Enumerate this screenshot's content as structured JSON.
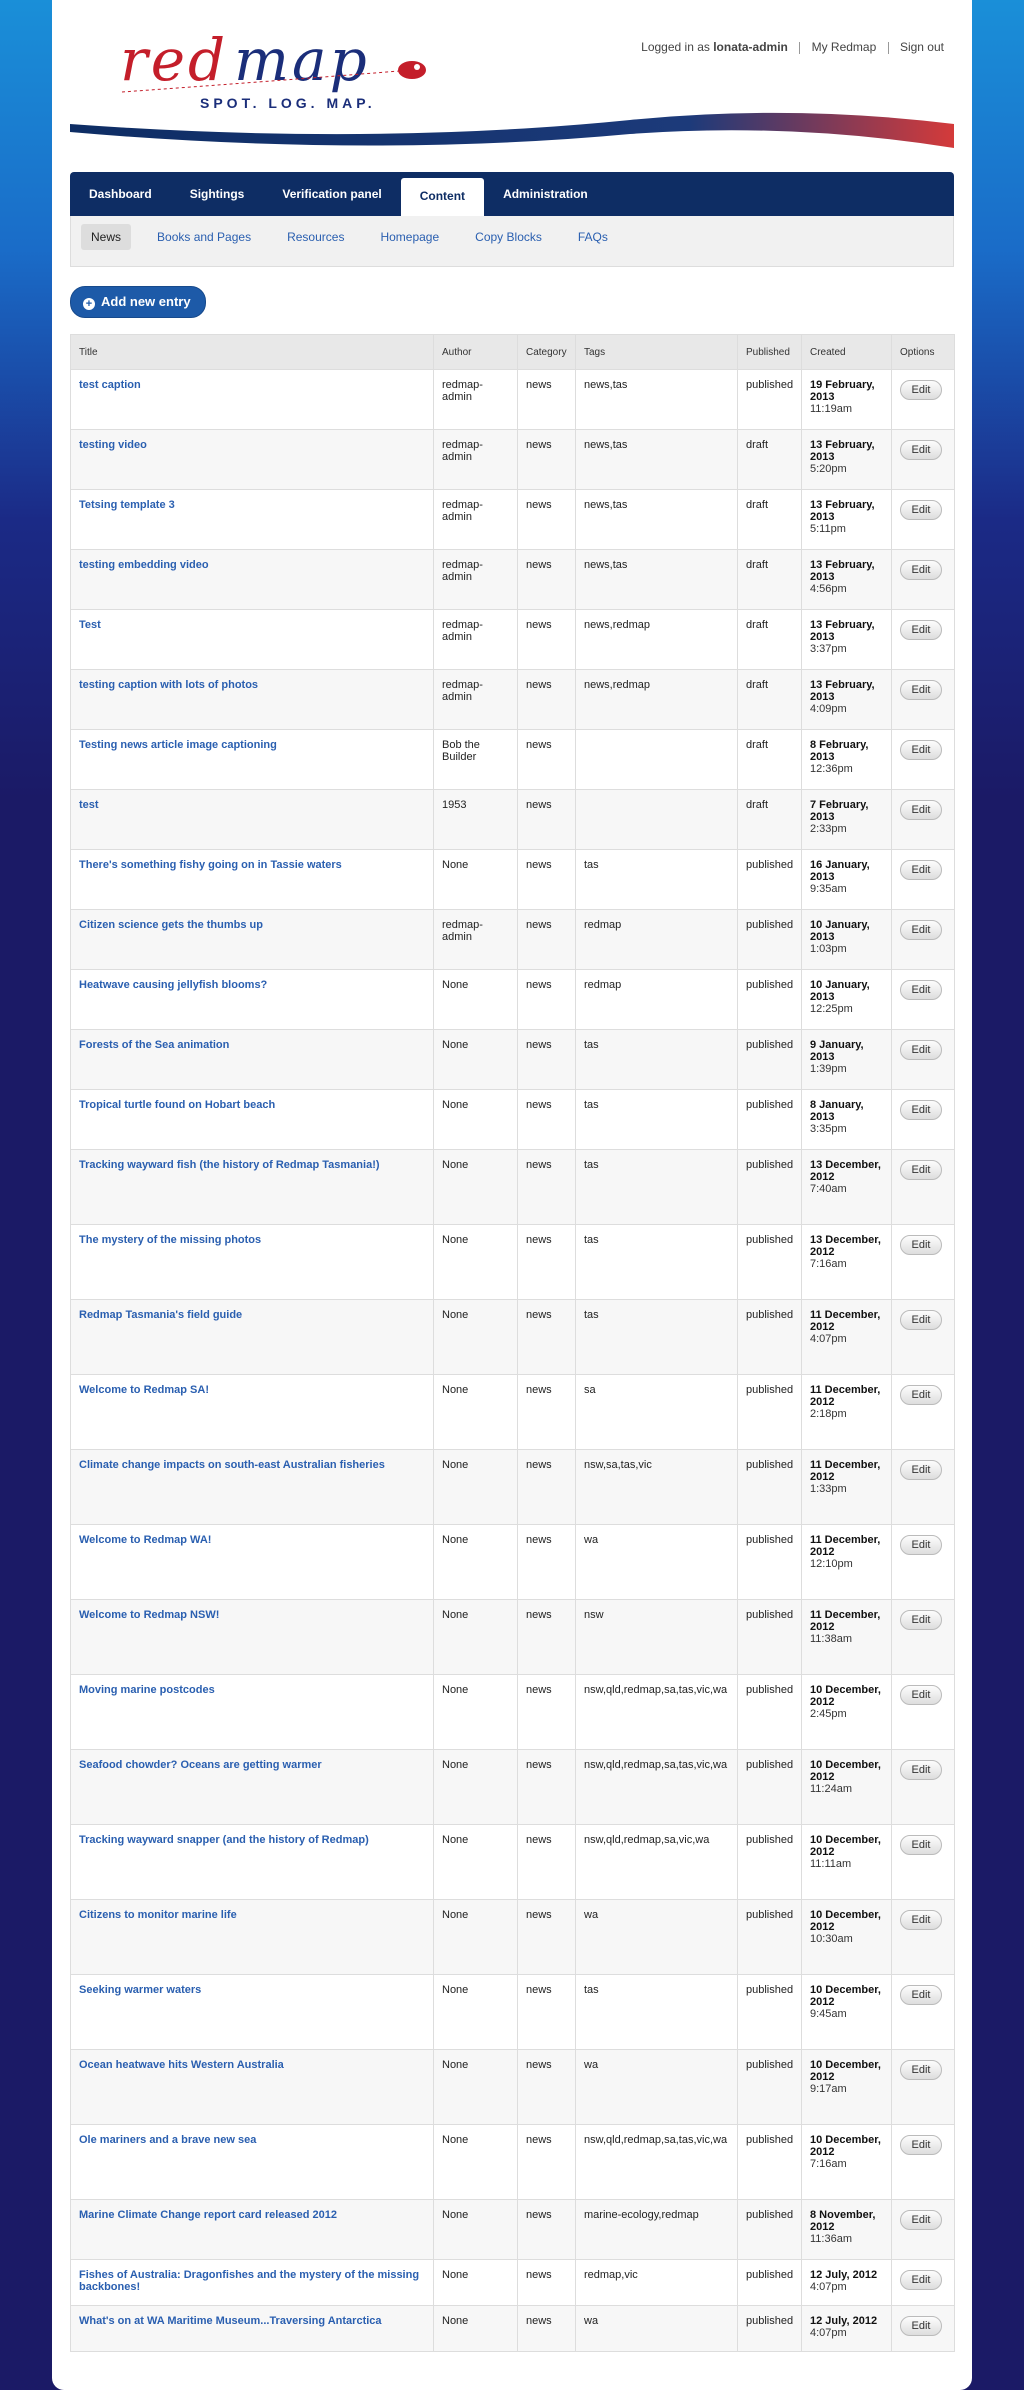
{
  "header": {
    "logo": "redmap",
    "tagline": "SPOT. LOG. MAP.",
    "logged_in_prefix": "Logged in as ",
    "username": "lonata-admin",
    "my_redmap": "My Redmap",
    "sign_out": "Sign out"
  },
  "nav": {
    "items": [
      "Dashboard",
      "Sightings",
      "Verification panel",
      "Content",
      "Administration"
    ],
    "active": "Content"
  },
  "subnav": {
    "items": [
      "News",
      "Books and Pages",
      "Resources",
      "Homepage",
      "Copy Blocks",
      "FAQs"
    ],
    "active": "News"
  },
  "add_button": "Add new entry",
  "table": {
    "headers": [
      "Title",
      "Author",
      "Category",
      "Tags",
      "Published",
      "Created",
      "Options"
    ],
    "edit_label": "Edit",
    "rows": [
      {
        "title": "test caption",
        "author": "redmap-admin",
        "category": "news",
        "tags": "news,tas",
        "published": "published",
        "date": "19 February, 2013",
        "time": "11:19am"
      },
      {
        "title": "testing video",
        "author": "redmap-admin",
        "category": "news",
        "tags": "news,tas",
        "published": "draft",
        "date": "13 February, 2013",
        "time": "5:20pm"
      },
      {
        "title": "Tetsing template 3",
        "author": "redmap-admin",
        "category": "news",
        "tags": "news,tas",
        "published": "draft",
        "date": "13 February, 2013",
        "time": "5:11pm"
      },
      {
        "title": "testing embedding video",
        "author": "redmap-admin",
        "category": "news",
        "tags": "news,tas",
        "published": "draft",
        "date": "13 February, 2013",
        "time": "4:56pm"
      },
      {
        "title": "Test",
        "author": "redmap-admin",
        "category": "news",
        "tags": "news,redmap",
        "published": "draft",
        "date": "13 February, 2013",
        "time": "3:37pm"
      },
      {
        "title": "testing caption with lots of photos",
        "author": "redmap-admin",
        "category": "news",
        "tags": "news,redmap",
        "published": "draft",
        "date": "13 February, 2013",
        "time": "4:09pm"
      },
      {
        "title": "Testing news article image captioning",
        "author": "Bob the Builder",
        "category": "news",
        "tags": "",
        "published": "draft",
        "date": "8 February, 2013",
        "time": "12:36pm"
      },
      {
        "title": "test",
        "author": "1953",
        "category": "news",
        "tags": "",
        "published": "draft",
        "date": "7 February, 2013",
        "time": "2:33pm"
      },
      {
        "title": "There's something fishy going on in Tassie waters",
        "author": "None",
        "category": "news",
        "tags": "tas",
        "published": "published",
        "date": "16 January, 2013",
        "time": "9:35am"
      },
      {
        "title": "Citizen science gets the thumbs up",
        "author": "redmap-admin",
        "category": "news",
        "tags": "redmap",
        "published": "published",
        "date": "10 January, 2013",
        "time": "1:03pm"
      },
      {
        "title": "Heatwave causing jellyfish blooms?",
        "author": "None",
        "category": "news",
        "tags": "redmap",
        "published": "published",
        "date": "10 January, 2013",
        "time": "12:25pm"
      },
      {
        "title": "Forests of the Sea animation",
        "author": "None",
        "category": "news",
        "tags": "tas",
        "published": "published",
        "date": "9 January, 2013",
        "time": "1:39pm"
      },
      {
        "title": "Tropical turtle found on Hobart beach",
        "author": "None",
        "category": "news",
        "tags": "tas",
        "published": "published",
        "date": "8 January, 2013",
        "time": "3:35pm"
      },
      {
        "title": "Tracking wayward fish (the history of Redmap Tasmania!)",
        "author": "None",
        "category": "news",
        "tags": "tas",
        "published": "published",
        "date": "13 December, 2012",
        "time": "7:40am"
      },
      {
        "title": "The mystery of the missing photos",
        "author": "None",
        "category": "news",
        "tags": "tas",
        "published": "published",
        "date": "13 December, 2012",
        "time": "7:16am"
      },
      {
        "title": "Redmap Tasmania's field guide",
        "author": "None",
        "category": "news",
        "tags": "tas",
        "published": "published",
        "date": "11 December, 2012",
        "time": "4:07pm"
      },
      {
        "title": "Welcome to Redmap SA!",
        "author": "None",
        "category": "news",
        "tags": "sa",
        "published": "published",
        "date": "11 December, 2012",
        "time": "2:18pm"
      },
      {
        "title": "Climate change impacts on south-east Australian fisheries",
        "author": "None",
        "category": "news",
        "tags": "nsw,sa,tas,vic",
        "published": "published",
        "date": "11 December, 2012",
        "time": "1:33pm"
      },
      {
        "title": "Welcome to Redmap WA!",
        "author": "None",
        "category": "news",
        "tags": "wa",
        "published": "published",
        "date": "11 December, 2012",
        "time": "12:10pm"
      },
      {
        "title": "Welcome to Redmap NSW!",
        "author": "None",
        "category": "news",
        "tags": "nsw",
        "published": "published",
        "date": "11 December, 2012",
        "time": "11:38am"
      },
      {
        "title": "Moving marine postcodes",
        "author": "None",
        "category": "news",
        "tags": "nsw,qld,redmap,sa,tas,vic,wa",
        "published": "published",
        "date": "10 December, 2012",
        "time": "2:45pm"
      },
      {
        "title": "Seafood chowder? Oceans are getting warmer",
        "author": "None",
        "category": "news",
        "tags": "nsw,qld,redmap,sa,tas,vic,wa",
        "published": "published",
        "date": "10 December, 2012",
        "time": "11:24am"
      },
      {
        "title": "Tracking wayward snapper (and the history of Redmap)",
        "author": "None",
        "category": "news",
        "tags": "nsw,qld,redmap,sa,vic,wa",
        "published": "published",
        "date": "10 December, 2012",
        "time": "11:11am"
      },
      {
        "title": "Citizens to monitor marine life",
        "author": "None",
        "category": "news",
        "tags": "wa",
        "published": "published",
        "date": "10 December, 2012",
        "time": "10:30am"
      },
      {
        "title": "Seeking warmer waters",
        "author": "None",
        "category": "news",
        "tags": "tas",
        "published": "published",
        "date": "10 December, 2012",
        "time": "9:45am"
      },
      {
        "title": "Ocean heatwave hits Western Australia",
        "author": "None",
        "category": "news",
        "tags": "wa",
        "published": "published",
        "date": "10 December, 2012",
        "time": "9:17am"
      },
      {
        "title": "Ole mariners and a brave new sea",
        "author": "None",
        "category": "news",
        "tags": "nsw,qld,redmap,sa,tas,vic,wa",
        "published": "published",
        "date": "10 December, 2012",
        "time": "7:16am"
      },
      {
        "title": "Marine Climate Change report card released 2012",
        "author": "None",
        "category": "news",
        "tags": "marine-ecology,redmap",
        "published": "published",
        "date": "8 November, 2012",
        "time": "11:36am"
      },
      {
        "title": "Fishes of Australia: Dragonfishes and the mystery of the missing backbones!",
        "author": "None",
        "category": "news",
        "tags": "redmap,vic",
        "published": "published",
        "date": "12 July, 2012",
        "time": "4:07pm"
      },
      {
        "title": "What's on at WA Maritime Museum...Traversing Antarctica",
        "author": "None",
        "category": "news",
        "tags": "wa",
        "published": "published",
        "date": "12 July, 2012",
        "time": "4:07pm"
      }
    ]
  }
}
